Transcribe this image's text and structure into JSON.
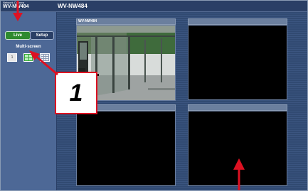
{
  "header": {
    "brand_line1": "Network Camera",
    "brand_line2": "WV-NW484",
    "model_title": "WV-NW484"
  },
  "sidebar": {
    "live_label": "Live",
    "setup_label": "Setup",
    "multiscreen_label": "Multi-screen",
    "multiscreen_buttons": [
      {
        "name": "single",
        "label": "1"
      },
      {
        "name": "quad",
        "label": "1-4"
      },
      {
        "name": "nine",
        "label": "1-9"
      }
    ]
  },
  "cameras": [
    {
      "title": "WV-NW484"
    },
    {
      "title": ""
    },
    {
      "title": ""
    },
    {
      "title": ""
    }
  ],
  "annotations": {
    "callout_number": "1",
    "arrow_color": "#dd1122"
  },
  "colors": {
    "live_active": "#2f8a2f",
    "quad_active": "#33aa33",
    "sidebar_bg": "#4d6896",
    "header_bg": "#2a3f66"
  }
}
